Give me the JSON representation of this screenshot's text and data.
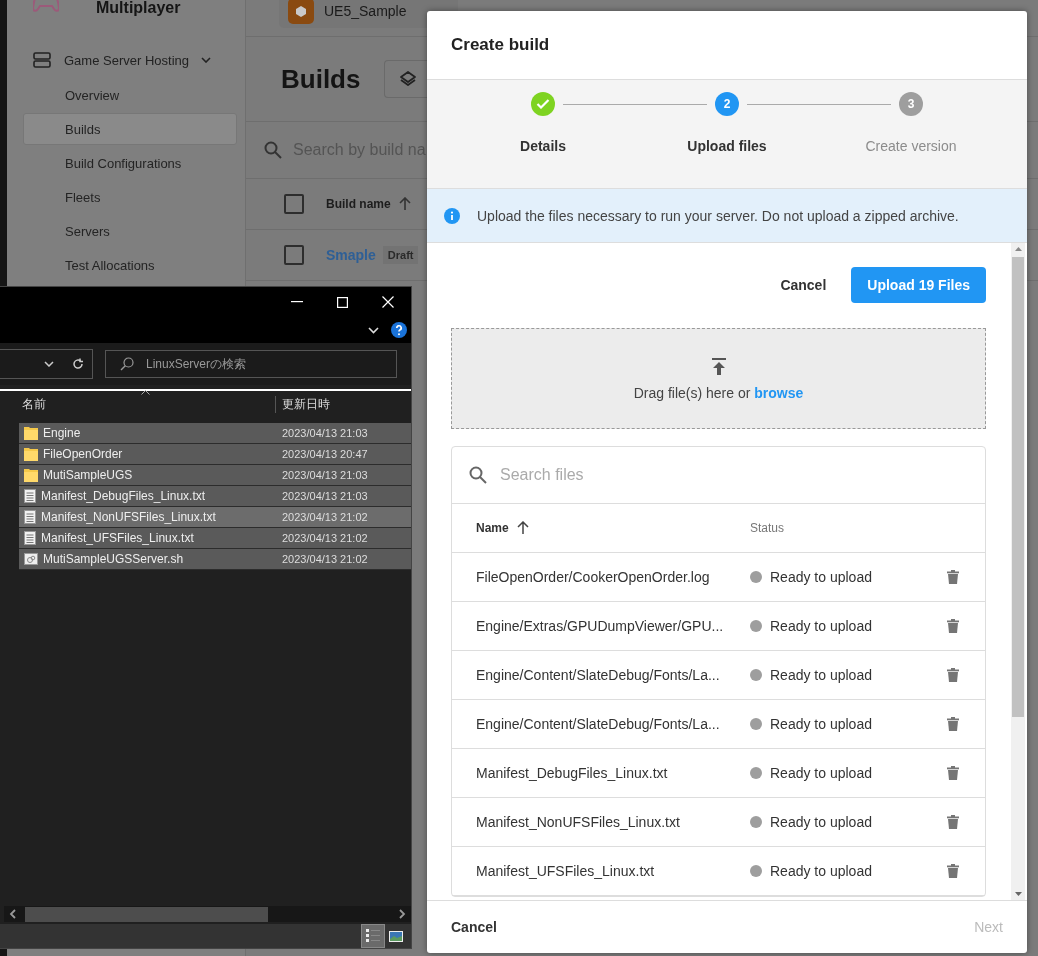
{
  "app": {
    "title": "Multiplayer",
    "project": "UE5_Sample"
  },
  "sidebar": {
    "group": {
      "label": "Game Server Hosting",
      "expanded": true,
      "children": [
        {
          "label": "Overview",
          "selected": false
        },
        {
          "label": "Builds",
          "selected": true
        },
        {
          "label": "Build Configurations",
          "selected": false
        },
        {
          "label": "Fleets",
          "selected": false
        },
        {
          "label": "Servers",
          "selected": false
        },
        {
          "label": "Test Allocations",
          "selected": false
        }
      ]
    }
  },
  "page": {
    "title": "Builds",
    "search": {
      "placeholder": "Search by build na"
    },
    "table": {
      "header_checked": false,
      "columns": [
        "Build name"
      ],
      "rows": [
        {
          "name": "Smaple",
          "badge": "Draft",
          "checked": false
        }
      ]
    }
  },
  "explorer": {
    "search": {
      "placeholder": "LinuxServerの検索"
    },
    "columns": [
      "名前",
      "更新日時"
    ],
    "rows": [
      {
        "name": "Engine",
        "modified": "2023/04/13 21:03",
        "kind": "folder",
        "selected": true,
        "hovered": false
      },
      {
        "name": "FileOpenOrder",
        "modified": "2023/04/13 20:47",
        "kind": "folder",
        "selected": true,
        "hovered": false
      },
      {
        "name": "MutiSampleUGS",
        "modified": "2023/04/13 21:03",
        "kind": "folder",
        "selected": true,
        "hovered": false
      },
      {
        "name": "Manifest_DebugFiles_Linux.txt",
        "modified": "2023/04/13 21:03",
        "kind": "text",
        "selected": true,
        "hovered": false
      },
      {
        "name": "Manifest_NonUFSFiles_Linux.txt",
        "modified": "2023/04/13 21:02",
        "kind": "text",
        "selected": true,
        "hovered": true
      },
      {
        "name": "Manifest_UFSFiles_Linux.txt",
        "modified": "2023/04/13 21:02",
        "kind": "text",
        "selected": true,
        "hovered": false
      },
      {
        "name": "MutiSampleUGSServer.sh",
        "modified": "2023/04/13 21:02",
        "kind": "script",
        "selected": true,
        "hovered": false
      }
    ]
  },
  "dialog": {
    "title": "Create build",
    "steps": [
      {
        "kind": "done",
        "label": "Details"
      },
      {
        "kind": "current",
        "number": "2",
        "label": "Upload files"
      },
      {
        "kind": "pending",
        "number": "3",
        "label": "Create version"
      }
    ],
    "notice": "Upload the files necessary to run your server. Do not upload a zipped archive.",
    "cancel": "Cancel",
    "upload": "Upload 19 Files",
    "dropzone": {
      "text": "Drag file(s) here or",
      "link": "browse"
    },
    "files": {
      "search": {
        "placeholder": "Search files"
      },
      "columns": [
        "Name",
        "Status"
      ],
      "rows": [
        {
          "name": "FileOpenOrder/CookerOpenOrder.log",
          "status": "Ready to upload"
        },
        {
          "name": "Engine/Extras/GPUDumpViewer/GPU...",
          "status": "Ready to upload"
        },
        {
          "name": "Engine/Content/SlateDebug/Fonts/La...",
          "status": "Ready to upload"
        },
        {
          "name": "Engine/Content/SlateDebug/Fonts/La...",
          "status": "Ready to upload"
        },
        {
          "name": "Manifest_DebugFiles_Linux.txt",
          "status": "Ready to upload"
        },
        {
          "name": "Manifest_NonUFSFiles_Linux.txt",
          "status": "Ready to upload"
        },
        {
          "name": "Manifest_UFSFiles_Linux.txt",
          "status": "Ready to upload"
        }
      ]
    },
    "footer": {
      "cancel": "Cancel",
      "next": {
        "label": "Next",
        "disabled": true
      }
    }
  }
}
